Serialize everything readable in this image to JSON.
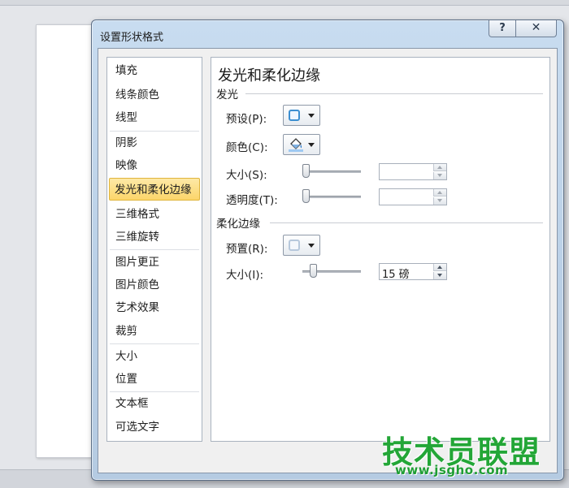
{
  "dialog": {
    "title": "设置形状格式",
    "help_label": "?",
    "close_label": "✕"
  },
  "categories": [
    {
      "label": "填充",
      "selected": false
    },
    {
      "label": "线条颜色",
      "selected": false
    },
    {
      "label": "线型",
      "selected": false
    },
    {
      "label": "阴影",
      "selected": false
    },
    {
      "label": "映像",
      "selected": false
    },
    {
      "label": "发光和柔化边缘",
      "selected": true
    },
    {
      "label": "三维格式",
      "selected": false
    },
    {
      "label": "三维旋转",
      "selected": false
    },
    {
      "label": "图片更正",
      "selected": false
    },
    {
      "label": "图片颜色",
      "selected": false
    },
    {
      "label": "艺术效果",
      "selected": false
    },
    {
      "label": "裁剪",
      "selected": false
    },
    {
      "label": "大小",
      "selected": false
    },
    {
      "label": "位置",
      "selected": false
    },
    {
      "label": "文本框",
      "selected": false
    },
    {
      "label": "可选文字",
      "selected": false
    }
  ],
  "panel": {
    "title": "发光和柔化边缘",
    "glow": {
      "heading": "发光",
      "preset_label": "预设(P):",
      "color_label": "颜色(C):",
      "size_label": "大小(S):",
      "size_value": "",
      "transparency_label": "透明度(T):",
      "transparency_value": "",
      "preset_icon": "glow-preset-icon",
      "color_icon": "paint-bucket-icon"
    },
    "soft_edges": {
      "heading": "柔化边缘",
      "preset_label": "预置(R):",
      "size_label": "大小(I):",
      "size_value": "15 磅",
      "preset_icon": "soft-edge-preset-icon"
    }
  },
  "watermark": {
    "text": "技术员联盟",
    "url": "www.jsgho.com"
  },
  "colors": {
    "selected_bg": "#fcd56a",
    "accent": "#3c8fd1",
    "watermark": "#23a637"
  }
}
